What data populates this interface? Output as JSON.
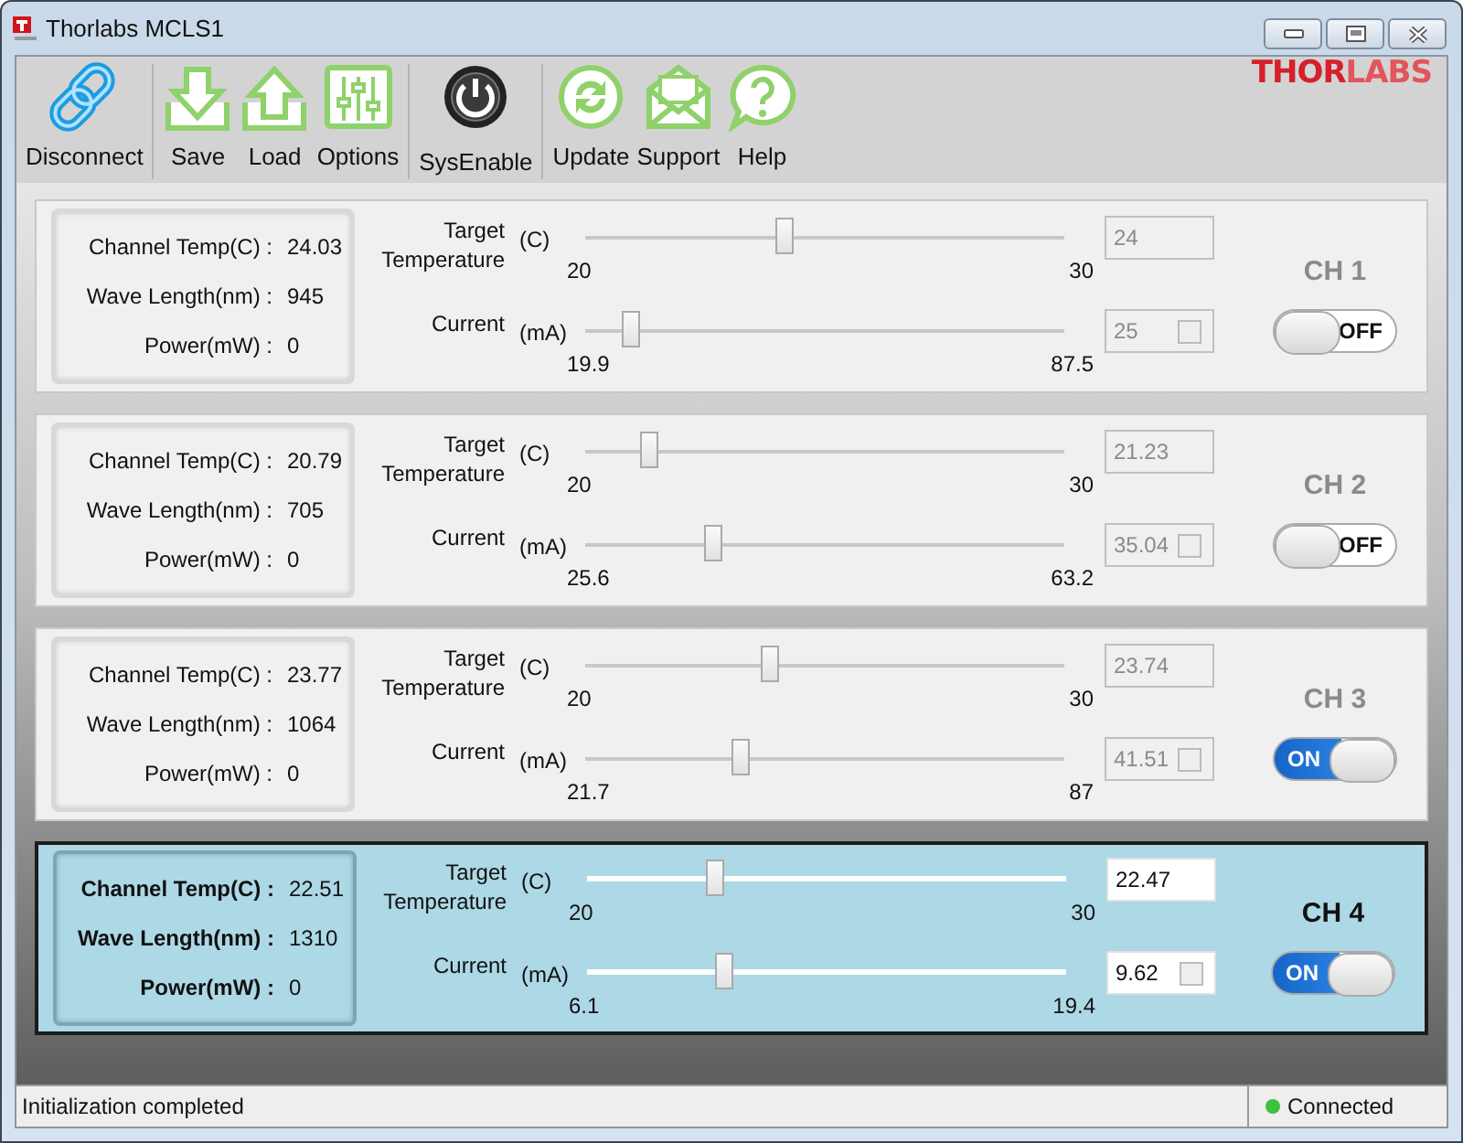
{
  "window": {
    "title": "Thorlabs MCLS1"
  },
  "toolbar": {
    "groups": [
      [
        {
          "label": "Disconnect",
          "kind": "link"
        }
      ],
      [
        {
          "label": "Save",
          "kind": "save"
        },
        {
          "label": "Load",
          "kind": "load"
        },
        {
          "label": "Options",
          "kind": "options"
        }
      ],
      [
        {
          "label": "SysEnable",
          "kind": "power"
        }
      ],
      [
        {
          "label": "Update",
          "kind": "update"
        },
        {
          "label": "Support",
          "kind": "mail"
        },
        {
          "label": "Help",
          "kind": "help"
        }
      ]
    ]
  },
  "logo": {
    "solid": "THOR",
    "outline": "LABS"
  },
  "channels": [
    {
      "name": "CH 1",
      "selected": false,
      "on": false,
      "switch_text": "OFF",
      "readings": [
        {
          "label": "Channel Temp(C) :",
          "value": "24.03"
        },
        {
          "label": "Wave Length(nm) :",
          "value": "945"
        },
        {
          "label": "Power(mW) :",
          "value": "0"
        }
      ],
      "temperature": {
        "label": "Target Temperature",
        "unit": "(C)",
        "min": "20",
        "max": "30",
        "level": 0.4,
        "value": "24"
      },
      "current": {
        "label": "Current",
        "unit": "(mA)",
        "min": "19.9",
        "max": "87.5",
        "level": 0.08,
        "value": "25",
        "checked": false
      }
    },
    {
      "name": "CH 2",
      "selected": false,
      "on": false,
      "switch_text": "OFF",
      "readings": [
        {
          "label": "Channel Temp(C) :",
          "value": "20.79"
        },
        {
          "label": "Wave Length(nm) :",
          "value": "705"
        },
        {
          "label": "Power(mW) :",
          "value": "0"
        }
      ],
      "temperature": {
        "label": "Target Temperature",
        "unit": "(C)",
        "min": "20",
        "max": "30",
        "level": 0.12,
        "value": "21.23"
      },
      "current": {
        "label": "Current",
        "unit": "(mA)",
        "min": "25.6",
        "max": "63.2",
        "level": 0.25,
        "value": "35.04",
        "checked": false
      }
    },
    {
      "name": "CH 3",
      "selected": false,
      "on": true,
      "switch_text": "ON",
      "readings": [
        {
          "label": "Channel Temp(C) :",
          "value": "23.77"
        },
        {
          "label": "Wave Length(nm) :",
          "value": "1064"
        },
        {
          "label": "Power(mW) :",
          "value": "0"
        }
      ],
      "temperature": {
        "label": "Target Temperature",
        "unit": "(C)",
        "min": "20",
        "max": "30",
        "level": 0.37,
        "value": "23.74"
      },
      "current": {
        "label": "Current",
        "unit": "(mA)",
        "min": "21.7",
        "max": "87",
        "level": 0.31,
        "value": "41.51",
        "checked": false
      }
    },
    {
      "name": "CH 4",
      "selected": true,
      "on": true,
      "switch_text": "ON",
      "readings": [
        {
          "label": "Channel Temp(C) :",
          "value": "22.51"
        },
        {
          "label": "Wave Length(nm) :",
          "value": "1310"
        },
        {
          "label": "Power(mW) :",
          "value": "0"
        }
      ],
      "temperature": {
        "label": "Target Temperature",
        "unit": "(C)",
        "min": "20",
        "max": "30",
        "level": 0.25,
        "value": "22.47"
      },
      "current": {
        "label": "Current",
        "unit": "(mA)",
        "min": "6.1",
        "max": "19.4",
        "level": 0.27,
        "value": "9.62",
        "checked": false
      }
    }
  ],
  "status_bar": {
    "message": "Initialization completed",
    "connection": "Connected",
    "connected": true
  }
}
